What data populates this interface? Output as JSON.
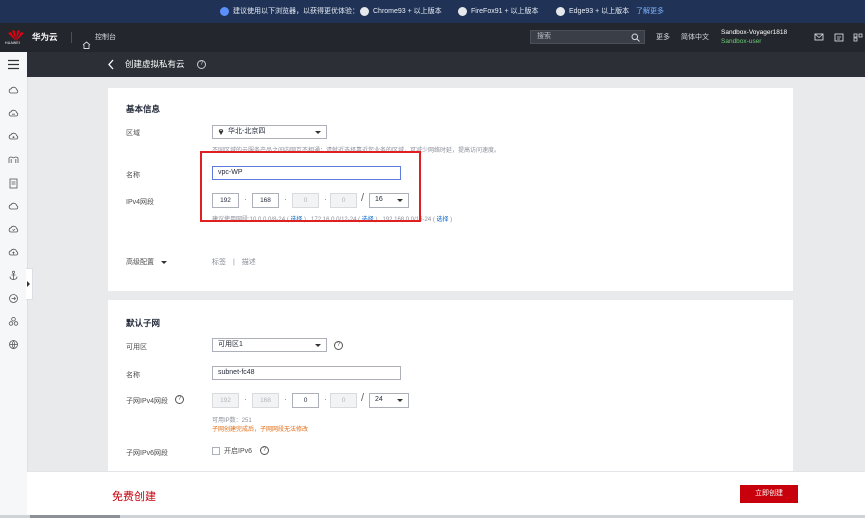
{
  "banner": {
    "notice": "建议使用以下浏览器，以获得更优体验：",
    "chrome": "Chrome93 + 以上版本",
    "firefox": "FireFox91 + 以上版本",
    "edge": "Edge93 + 以上版本",
    "learn_more": "了解更多"
  },
  "header": {
    "brand_small": "HUAWEI",
    "brand": "华为云",
    "console": "控制台",
    "search_placeholder": "搜索",
    "more": "更多",
    "language": "简体中文",
    "account": "Sandbox-Voyager1818",
    "user": "Sandbox-user"
  },
  "page": {
    "title": "创建虚拟私有云"
  },
  "basic": {
    "section_title": "基本信息",
    "region_label": "区域",
    "region_value": "华北-北京四",
    "region_hint": "不同区域的云服务产品之间内网互不相通；请就近选择靠近您业务的区域，可减少网络时延，提高访问速度。",
    "name_label": "名称",
    "name_value": "vpc-WP",
    "cidr_label": "IPv4网段",
    "cidr_octets": [
      "192",
      "168",
      "0",
      "0"
    ],
    "cidr_mask": "16",
    "cidr_hint_text": "建议使用网段:10.0.0.0/8-24 ( ",
    "cidr_hint_select1": "选择",
    "cidr_hint_mid1": " ) , 172.16.0.0/12-24 ( ",
    "cidr_hint_select2": "选择",
    "cidr_hint_mid2": " ) , 192.168.0.0/16-24 ( ",
    "cidr_hint_select3": "选择",
    "cidr_hint_end": " )",
    "advanced_label": "高级配置",
    "advanced_tags": "标签",
    "advanced_sep": "|",
    "advanced_desc": "描述"
  },
  "subnet": {
    "section_title": "默认子网",
    "az_label": "可用区",
    "az_value": "可用区1",
    "name_label": "名称",
    "name_value": "subnet-fc48",
    "cidr_label": "子网IPv4网段",
    "cidr_octets": [
      "192",
      "168",
      "0",
      "0"
    ],
    "cidr_mask": "24",
    "available_ips": "可用IP数：251",
    "cidr_warning": "子网创建完成后，子网网段无法修改",
    "ipv6_label": "子网IPv6网段",
    "ipv6_option": "开启IPv6"
  },
  "footer": {
    "price": "免费创建",
    "submit": "立即创建"
  },
  "colors": {
    "accent": "#c7000b",
    "link": "#0066cc",
    "warning": "#e36b13",
    "banner_bg": "#203356",
    "header_bg": "#23262c"
  }
}
